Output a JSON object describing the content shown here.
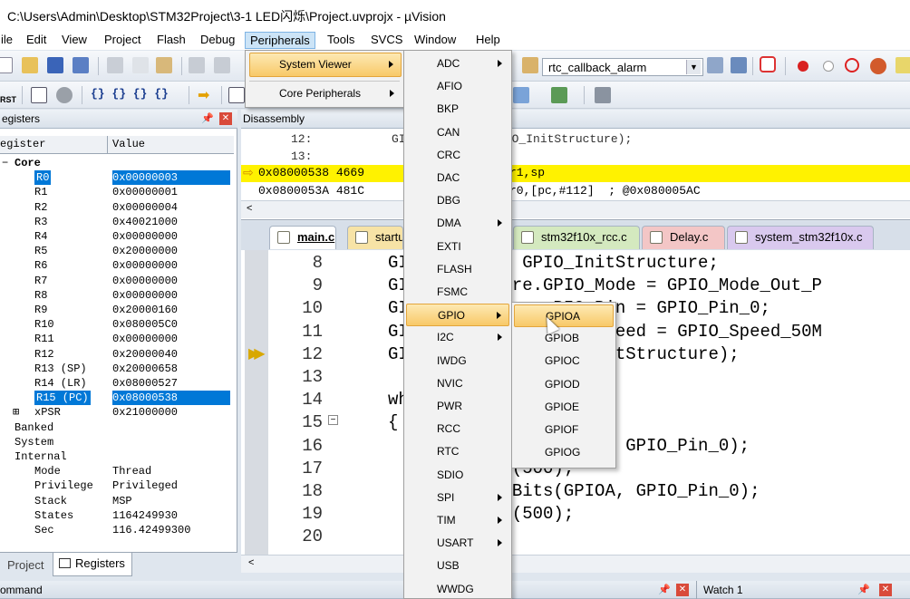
{
  "window": {
    "title": "C:\\Users\\Admin\\Desktop\\STM32Project\\3-1 LED闪烁\\Project.uvprojx - µVision"
  },
  "menubar": {
    "items": [
      "ile",
      "Edit",
      "View",
      "Project",
      "Flash",
      "Debug",
      "Peripherals",
      "Tools",
      "SVCS",
      "Window",
      "Help"
    ]
  },
  "toolbar": {
    "target_value": "rtc_callback_alarm",
    "rst_label": "RST"
  },
  "registers_pane": {
    "title": "egisters",
    "col_register": "egister",
    "col_value": "Value",
    "rows": [
      {
        "name": "Core",
        "value": ""
      },
      {
        "name": "R0",
        "value": "0x00000003"
      },
      {
        "name": "R1",
        "value": "0x00000001"
      },
      {
        "name": "R2",
        "value": "0x00000004"
      },
      {
        "name": "R3",
        "value": "0x40021000"
      },
      {
        "name": "R4",
        "value": "0x00000000"
      },
      {
        "name": "R5",
        "value": "0x20000000"
      },
      {
        "name": "R6",
        "value": "0x00000000"
      },
      {
        "name": "R7",
        "value": "0x00000000"
      },
      {
        "name": "R8",
        "value": "0x00000000"
      },
      {
        "name": "R9",
        "value": "0x20000160"
      },
      {
        "name": "R10",
        "value": "0x080005C0"
      },
      {
        "name": "R11",
        "value": "0x00000000"
      },
      {
        "name": "R12",
        "value": "0x20000040"
      },
      {
        "name": "R13 (SP)",
        "value": "0x20000658"
      },
      {
        "name": "R14 (LR)",
        "value": "0x08000527"
      },
      {
        "name": "R15 (PC)",
        "value": "0x08000538"
      },
      {
        "name": "xPSR",
        "value": "0x21000000"
      },
      {
        "name": "Banked",
        "value": ""
      },
      {
        "name": "System",
        "value": ""
      },
      {
        "name": "Internal",
        "value": ""
      },
      {
        "name": "Mode",
        "value": "Thread"
      },
      {
        "name": "Privilege",
        "value": "Privileged"
      },
      {
        "name": "Stack",
        "value": "MSP"
      },
      {
        "name": "States",
        "value": "1164249930"
      },
      {
        "name": "Sec",
        "value": "116.42499300"
      }
    ],
    "tab_project": "Project",
    "tab_registers": "Registers"
  },
  "disassembly": {
    "title": "Disassembly",
    "line1_no": "12:",
    "line1_code": "GI        A, &GPIO_InitStructure);",
    "line2_no": "13:",
    "line3_addr": "0x08000538 4669",
    "line3_code": "r1,sp",
    "line4_addr": "0x0800053A 481C",
    "line4_code": "r0,[pc,#112]  ; @0x080005AC"
  },
  "tabs": [
    "main.c",
    "startu",
    "stm32f10x_rcc.c",
    "Delay.c",
    "system_stm32f10x.c"
  ],
  "code": {
    "lines": [
      {
        "no": "8",
        "text": "GI     peDef GPIO_InitStructure;"
      },
      {
        "no": "9",
        "text": "GI     ructure.GPIO_Mode = GPIO_Mode_Out_P"
      },
      {
        "no": "10",
        "text": "GI              PIO_Pin = GPIO_Pin_0;"
      },
      {
        "no": "11",
        "text": "GI              PIO_Speed = GPIO_Speed_50M"
      },
      {
        "no": "12",
        "text": "GI              IO_InitStructure);"
      },
      {
        "no": "13",
        "text": ""
      },
      {
        "no": "14",
        "text": "wh"
      },
      {
        "no": "15",
        "text": "{"
      },
      {
        "no": "16",
        "text": "                 PIOA, GPIO_Pin_0);"
      },
      {
        "no": "17",
        "text": "           s(500);"
      },
      {
        "no": "18",
        "text": "           tBits(GPIOA, GPIO_Pin_0);"
      },
      {
        "no": "19",
        "text": "           s(500);"
      },
      {
        "no": "20",
        "text": ""
      }
    ]
  },
  "peripherals_menu": {
    "items": [
      "System Viewer",
      "Core Peripherals"
    ]
  },
  "system_viewer_menu": {
    "items": [
      "ADC",
      "AFIO",
      "BKP",
      "CAN",
      "CRC",
      "DAC",
      "DBG",
      "DMA",
      "EXTI",
      "FLASH",
      "FSMC",
      "GPIO",
      "I2C",
      "IWDG",
      "NVIC",
      "PWR",
      "RCC",
      "RTC",
      "SDIO",
      "SPI",
      "TIM",
      "USART",
      "USB",
      "WWDG"
    ]
  },
  "gpio_menu": {
    "items": [
      "GPIOA",
      "GPIOB",
      "GPIOC",
      "GPIOD",
      "GPIOE",
      "GPIOF",
      "GPIOG"
    ]
  },
  "bottom": {
    "command": "ommand",
    "watch": "Watch 1"
  },
  "colors": {
    "accent": "#0078d7",
    "highlight": "#f8c968",
    "current_line": "#fff200"
  }
}
